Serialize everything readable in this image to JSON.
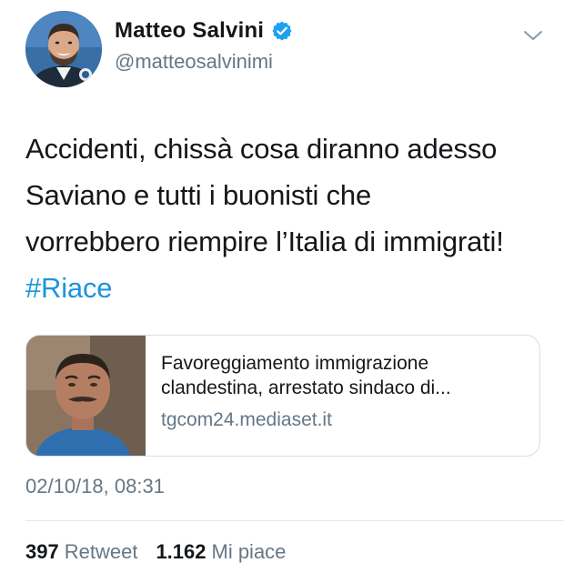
{
  "author": {
    "display_name": "Matteo Salvini",
    "handle": "@matteosalvinimi",
    "verified": true
  },
  "tweet": {
    "text_lines": [
      "Accidenti, chissà cosa diranno adesso",
      "Saviano e tutti i buonisti che",
      "vorrebbero riempire l’Italia di immigrati!"
    ],
    "hashtag": "#Riace"
  },
  "link_card": {
    "title_lines": [
      "Favoreggiamento immigrazione",
      "clandestina, arrestato sindaco di..."
    ],
    "domain": "tgcom24.mediaset.it"
  },
  "timestamp": "02/10/18, 08:31",
  "stats": {
    "retweets_count": "397",
    "retweets_label": "Retweet",
    "likes_count": "1.162",
    "likes_label": "Mi piace"
  },
  "colors": {
    "link_blue": "#1b95e0",
    "text_primary": "#14171a",
    "text_secondary": "#657786",
    "verified_badge": "#1da1f2",
    "border": "#e1e8ed"
  },
  "icons": {
    "verified": "verified-badge-icon",
    "menu": "chevron-down-icon"
  }
}
